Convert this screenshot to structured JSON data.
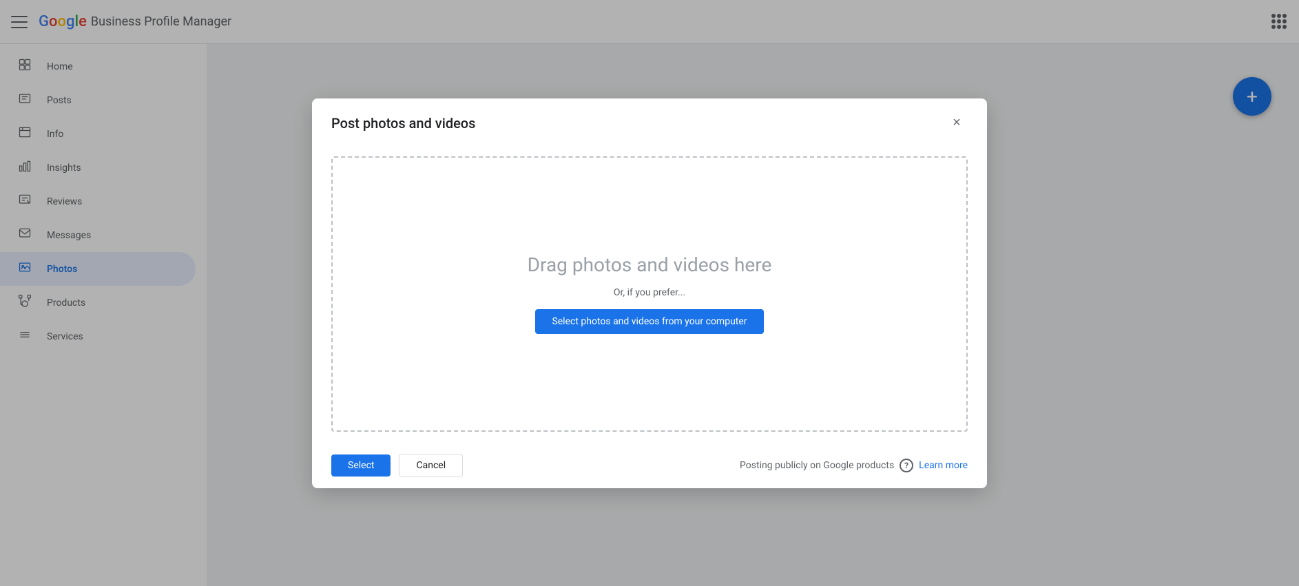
{
  "topbar": {
    "menu_icon": "hamburger",
    "logo_google": "Google",
    "logo_text": "Business Profile Manager",
    "grid_icon": "grid"
  },
  "sidebar": {
    "items": [
      {
        "id": "home",
        "label": "Home",
        "icon": "⊞",
        "active": false
      },
      {
        "id": "posts",
        "label": "Posts",
        "icon": "☰",
        "active": false
      },
      {
        "id": "info",
        "label": "Info",
        "icon": "🏪",
        "active": false
      },
      {
        "id": "insights",
        "label": "Insights",
        "icon": "📊",
        "active": false
      },
      {
        "id": "reviews",
        "label": "Reviews",
        "icon": "⭐",
        "active": false
      },
      {
        "id": "messages",
        "label": "Messages",
        "icon": "💬",
        "active": false
      },
      {
        "id": "photos",
        "label": "Photos",
        "icon": "🖼",
        "active": true
      },
      {
        "id": "products",
        "label": "Products",
        "icon": "🛍",
        "active": false
      },
      {
        "id": "services",
        "label": "Services",
        "icon": "—",
        "active": false
      }
    ]
  },
  "fab": {
    "label": "+"
  },
  "modal": {
    "title": "Post photos and videos",
    "close_label": "×",
    "drop_zone": {
      "title": "Drag photos and videos here",
      "subtitle": "Or, if you prefer...",
      "select_button_label": "Select photos and videos from your computer"
    },
    "footer": {
      "select_label": "Select",
      "cancel_label": "Cancel",
      "posting_info": "Posting publicly on Google products",
      "help_icon": "?",
      "learn_more_label": "Learn more"
    }
  }
}
